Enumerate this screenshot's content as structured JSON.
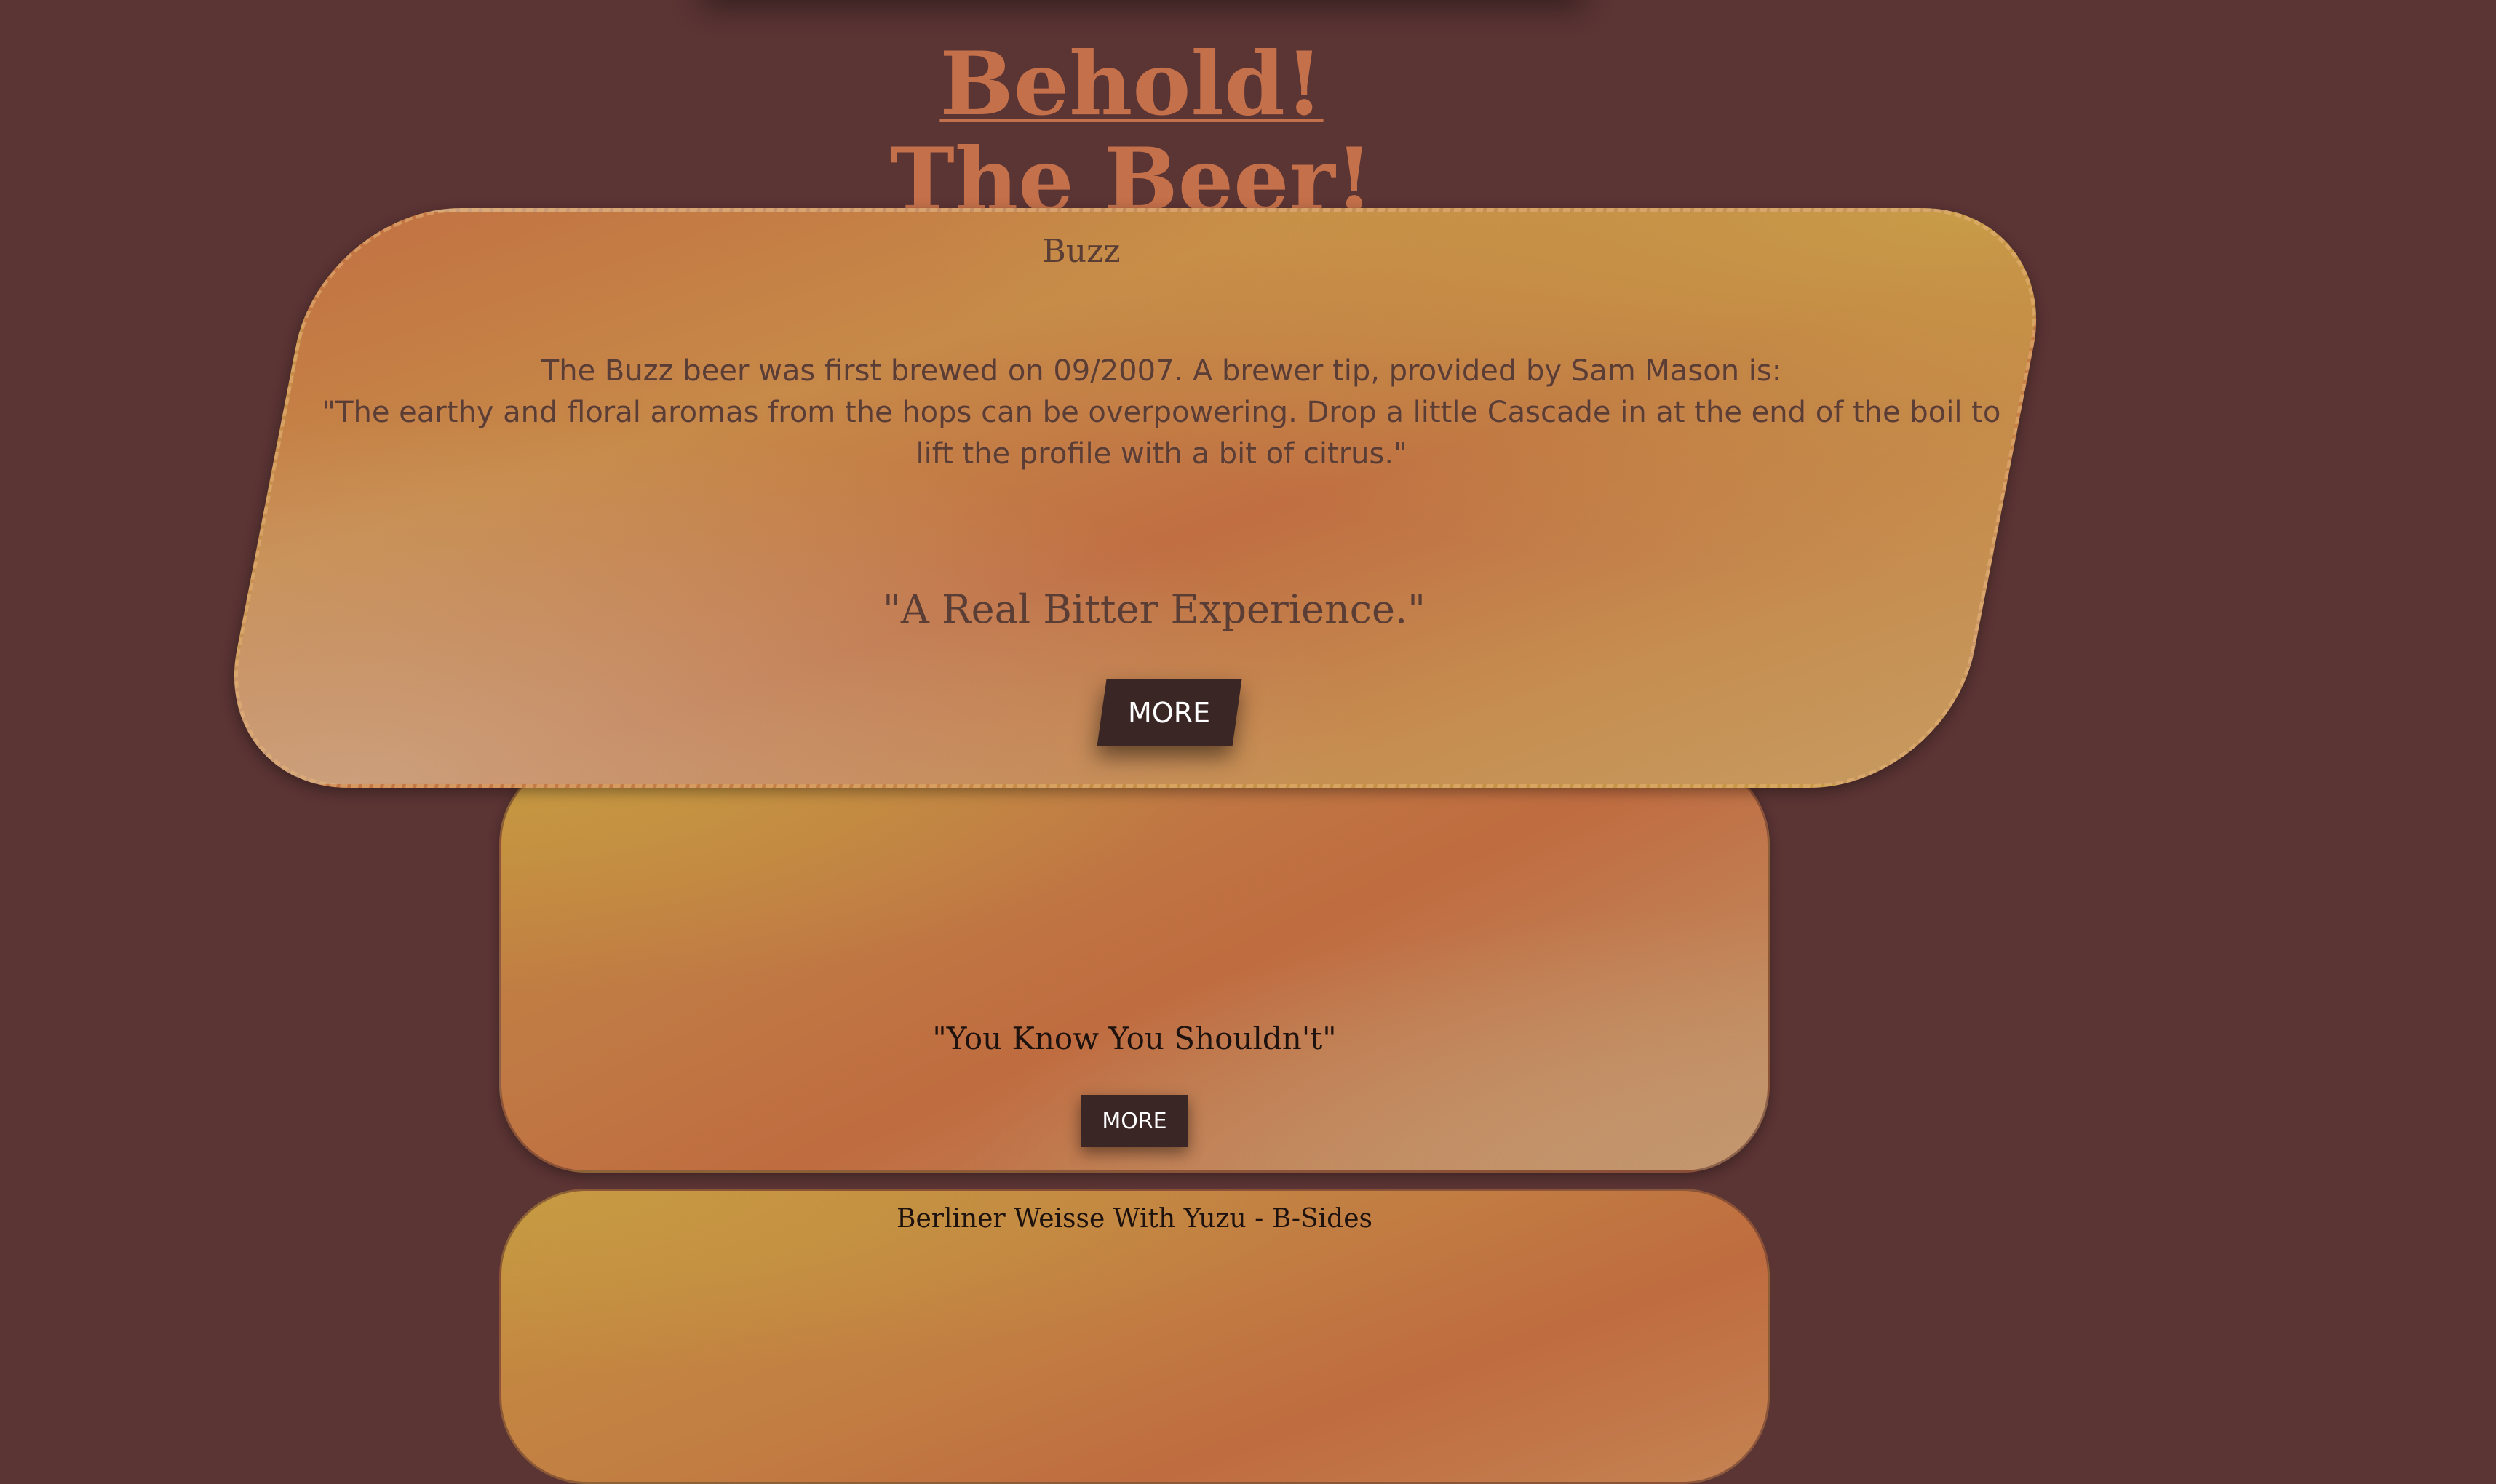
{
  "header": {
    "title_line1": "Behold!",
    "title_line2": "The Beer!"
  },
  "cards": [
    {
      "name": "Buzz",
      "description_line1": "The Buzz beer was first brewed on 09/2007. A brewer tip, provided by Sam Mason is:",
      "description_line2": "\"The earthy and floral aromas from the hops can be overpowering. Drop a little Cascade in at the end of the boil to lift the profile with a bit of citrus.\"",
      "tagline": "\"A Real Bitter Experience.\"",
      "more_label": "MORE"
    },
    {
      "tagline": "\"You Know You Shouldn't\"",
      "more_label": "MORE"
    },
    {
      "name": "Berliner Weisse With Yuzu - B-Sides"
    }
  ],
  "colors": {
    "background": "#5b3434",
    "title": "#c4704a",
    "button": "#3b2626",
    "card_gold": "#c69a42",
    "card_orange": "#bf6c40"
  }
}
